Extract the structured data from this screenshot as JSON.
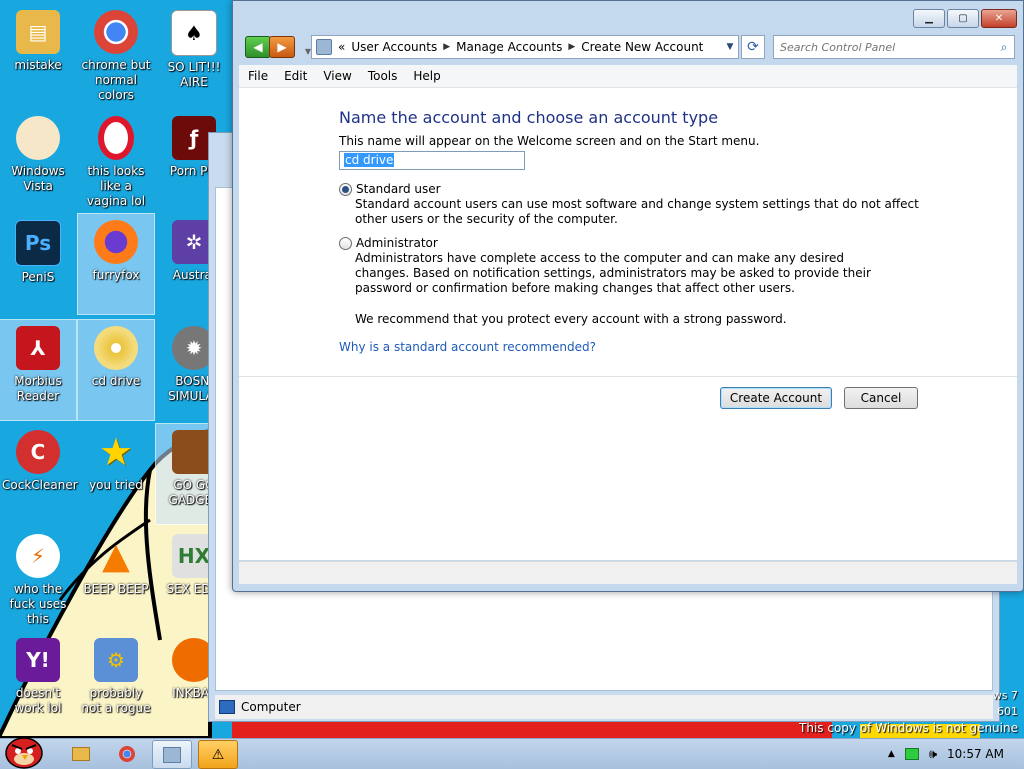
{
  "colors": {
    "desktop": "#19a7e0",
    "heading": "#1e3287",
    "link": "#1e5bb8",
    "accent": "#3399ff"
  },
  "desktop_icons": [
    {
      "label": "mistake",
      "icon": "folder-icon"
    },
    {
      "label": "chrome but normal colors",
      "icon": "chrome-icon"
    },
    {
      "label": "SO LIT!!! AIRE",
      "icon": "solitaire-icon"
    },
    {
      "label": "Windows Vista",
      "icon": "egg-icon"
    },
    {
      "label": "this looks like a vagina lol",
      "icon": "opera-icon"
    },
    {
      "label": "Porn Pla",
      "icon": "flash-icon"
    },
    {
      "label": "PeniS",
      "icon": "photoshop-icon"
    },
    {
      "label": "furryfox",
      "icon": "firefox-icon"
    },
    {
      "label": "Austral",
      "icon": "spider-solitaire-icon"
    },
    {
      "label": "Morbius Reader",
      "icon": "pdf-reader-icon"
    },
    {
      "label": "cd drive",
      "icon": "cd-icon"
    },
    {
      "label": "BOSNI SIMULAT",
      "icon": "mine-icon"
    },
    {
      "label": "CockCleaner",
      "icon": "ccleaner-icon"
    },
    {
      "label": "you tried",
      "icon": "star-icon"
    },
    {
      "label": "GO GO GADGET",
      "icon": "briefcase-icon"
    },
    {
      "label": "who the fuck uses this",
      "icon": "lightning-icon"
    },
    {
      "label": "BEEP BEEP",
      "icon": "vlc-icon"
    },
    {
      "label": "SEX EDIT",
      "icon": "hex-editor-icon"
    },
    {
      "label": "doesn't work lol",
      "icon": "yahoo-icon"
    },
    {
      "label": "probably not a rogue",
      "icon": "monitor-gear-icon"
    },
    {
      "label": "INKBAL",
      "icon": "inkball-icon"
    }
  ],
  "window": {
    "breadcrumbs": [
      "User Accounts",
      "Manage Accounts",
      "Create New Account"
    ],
    "breadcrumb_prefix": "«",
    "search_placeholder": "Search Control Panel",
    "menu": [
      "File",
      "Edit",
      "View",
      "Tools",
      "Help"
    ],
    "heading": "Name the account and choose an account type",
    "subtext": "This name will appear on the Welcome screen and on the Start menu.",
    "name_value": "cd drive",
    "options": [
      {
        "label": "Standard user",
        "selected": true,
        "description": "Standard account users can use most software and change system settings that do not affect other users or the security of the computer."
      },
      {
        "label": "Administrator",
        "selected": false,
        "description": "Administrators have complete access to the computer and can make any desired changes. Based on notification settings, administrators may be asked to provide their password or confirmation before making changes that affect other users."
      }
    ],
    "recommendation": "We recommend that you protect every account with a strong password.",
    "why_link": "Why is a standard account recommended?",
    "create_button": "Create Account",
    "cancel_button": "Cancel"
  },
  "background_window": {
    "status_text": "Computer"
  },
  "desktop_text": {
    "windows_info_1": "ws 7",
    "windows_info_2": "601",
    "not_genuine": "This copy of Windows is not genuine"
  },
  "taskbar": {
    "clock": "10:57 AM"
  }
}
